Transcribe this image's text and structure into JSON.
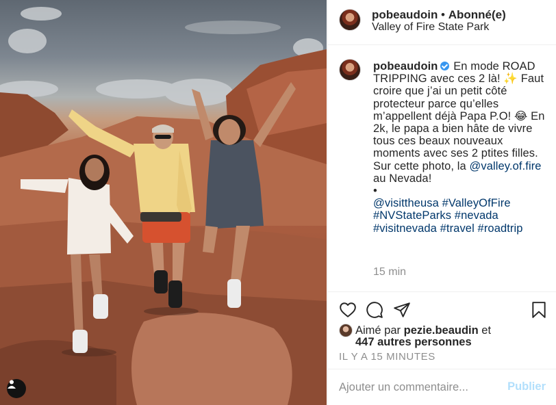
{
  "post": {
    "photo_alt": "photo",
    "tag_icon": "user-tag-icon"
  },
  "header": {
    "username": "pobeaudoin",
    "separator": " • ",
    "follow_status": "Abonné(e)",
    "location": "Valley of Fire State Park"
  },
  "caption": {
    "username": "pobeaudoin",
    "text_1": "En mode ROAD TRIPPING avec ces 2 là! ✨ Faut croire que j’ai un petit côté protecteur parce qu’elles m’appellent déjà Papa P.O! 😂 En 2k, le papa a bien hâte de vivre tous ces beaux nouveaux moments avec ses 2 ptites filles. Sur cette photo, la ",
    "mention_valley": "@valley.of.fire",
    "text_2": " au Nevada!",
    "bullet": "•",
    "mention_visit": "@visittheusa",
    "tags": [
      "#ValleyOfFire",
      "#NVStateParks",
      "#nevada",
      "#visitnevada",
      "#travel",
      "#roadtrip"
    ],
    "time": "15 min"
  },
  "actions": {
    "like_icon": "heart-icon",
    "comment_icon": "comment-icon",
    "share_icon": "share-icon",
    "save_icon": "bookmark-icon"
  },
  "likes": {
    "prefix": "Aimé par ",
    "user": "pezie.beaudin",
    "connector": " et",
    "others": "447 autres personnes"
  },
  "timestamp": "IL Y A 15 MINUTES",
  "comment": {
    "placeholder": "Ajouter un commentaire...",
    "publish_label": "Publier"
  },
  "colors": {
    "link": "#00376b",
    "verified": "#3897f0",
    "publish_disabled": "#b2dffc",
    "secondary_text": "#8e8e8e"
  }
}
